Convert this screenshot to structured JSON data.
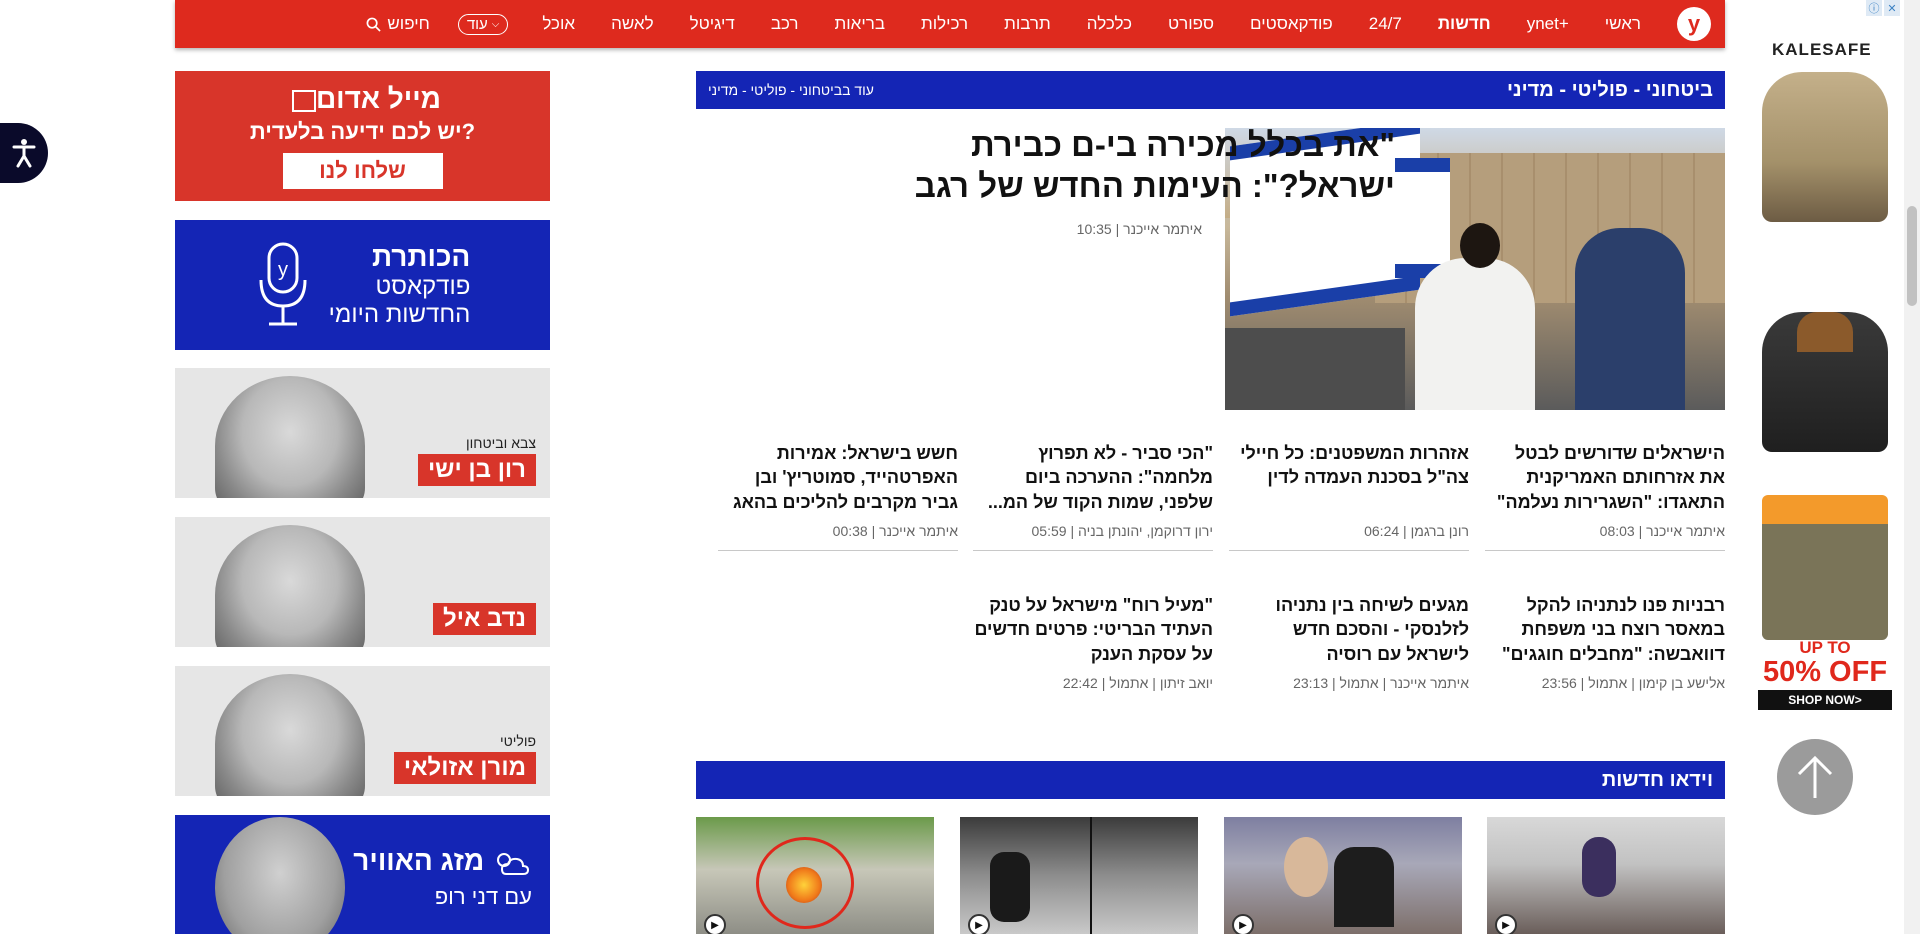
{
  "nav": {
    "logo": "y",
    "items": [
      {
        "label": "ראשי",
        "bold": false
      },
      {
        "label": "ynet+",
        "bold": false
      },
      {
        "label": "חדשות",
        "bold": true
      },
      {
        "label": "24/7",
        "bold": false
      },
      {
        "label": "פודקאסטים",
        "bold": false
      },
      {
        "label": "ספורט",
        "bold": false
      },
      {
        "label": "כלכלה",
        "bold": false
      },
      {
        "label": "תרבות",
        "bold": false
      },
      {
        "label": "רכילות",
        "bold": false
      },
      {
        "label": "בריאות",
        "bold": false
      },
      {
        "label": "רכב",
        "bold": false
      },
      {
        "label": "דיגיטל",
        "bold": false
      },
      {
        "label": "לאשה",
        "bold": false
      },
      {
        "label": "אוכל",
        "bold": false
      }
    ],
    "more_label": "עוד",
    "search_label": "חיפוש"
  },
  "promos": {
    "red": {
      "title": "מייל אדום",
      "subtitle": "יש לכם ידיעה בלעדית?",
      "button": "שלחו לנו"
    },
    "podcast": {
      "title": "הכותרת",
      "line1": "פודקאסט",
      "line2": "החדשות היומי"
    },
    "columnists": [
      {
        "section": "צבא וביטחון",
        "name": "רון בן ישי"
      },
      {
        "section": "",
        "name": "נדב איל"
      },
      {
        "section": "פוליטי",
        "name": "מורן אזולאי"
      }
    ],
    "weather": {
      "title": "מזג האוויר",
      "subtitle": "עם דני רופ"
    }
  },
  "section": {
    "title": "ביטחוני - פוליטי - מדיני",
    "more": "עוד בביטחוני - פוליטי - מדיני"
  },
  "main_article": {
    "title": "\"את בכלל מכירה בי-ם כבירת ישראל?\": העימות החדש של רגב",
    "author": "איתמר אייכנר",
    "time": "10:35"
  },
  "articles": [
    {
      "title": "הישראלים שדורשים לבטל את אזרחותם האמריקנית התאגדו: \"השגרירות נעלמה\"",
      "author": "איתמר אייכנר",
      "time": "08:03"
    },
    {
      "title": "אזהרות המשפטנים: כל חיילי צה\"ל בסכנת העמדה לדין",
      "author": "רונן ברגמן",
      "time": "06:24"
    },
    {
      "title": "\"הכי סביר - לא תפרוץ מלחמה\": ההערכה ביום שלפני, שמות הקוד של המ...",
      "author": "ירון דרוקמן, יהונתן בניה",
      "time": "05:59"
    },
    {
      "title": "חשש בישראל: אמירות האפרטהייד, סמוטריץ' ובן גביר מקרבים להליכים בהאג",
      "author": "איתמר אייכנר",
      "time": "00:38"
    },
    {
      "title": "רבניות פנו לנתניהו להקל במאסר רוצח בני משפחת דוואבשה: \"מחבלים חוגגים\"",
      "author": "אלישע בן קימון",
      "time": "אתמול | 23:56"
    },
    {
      "title": "מגעים לשיחה בין נתניהו לזלנסקי - והסכם חדש לישראל עם רוסיה",
      "author": "איתמר אייכנר",
      "time": "אתמול | 23:13"
    },
    {
      "title": "\"מעיל רוח\" מישראל על טנק העתיד הבריטי: פרטים חדשים על עסקת הענק",
      "author": "יואב זיתון",
      "time": "אתמול | 22:42"
    }
  ],
  "video_section": {
    "title": "וידאו חדשות"
  },
  "ad": {
    "brand": "KALESAFE",
    "up_to": "UP TO",
    "discount": "50% OFF",
    "cta": "SHOP NOW>"
  }
}
